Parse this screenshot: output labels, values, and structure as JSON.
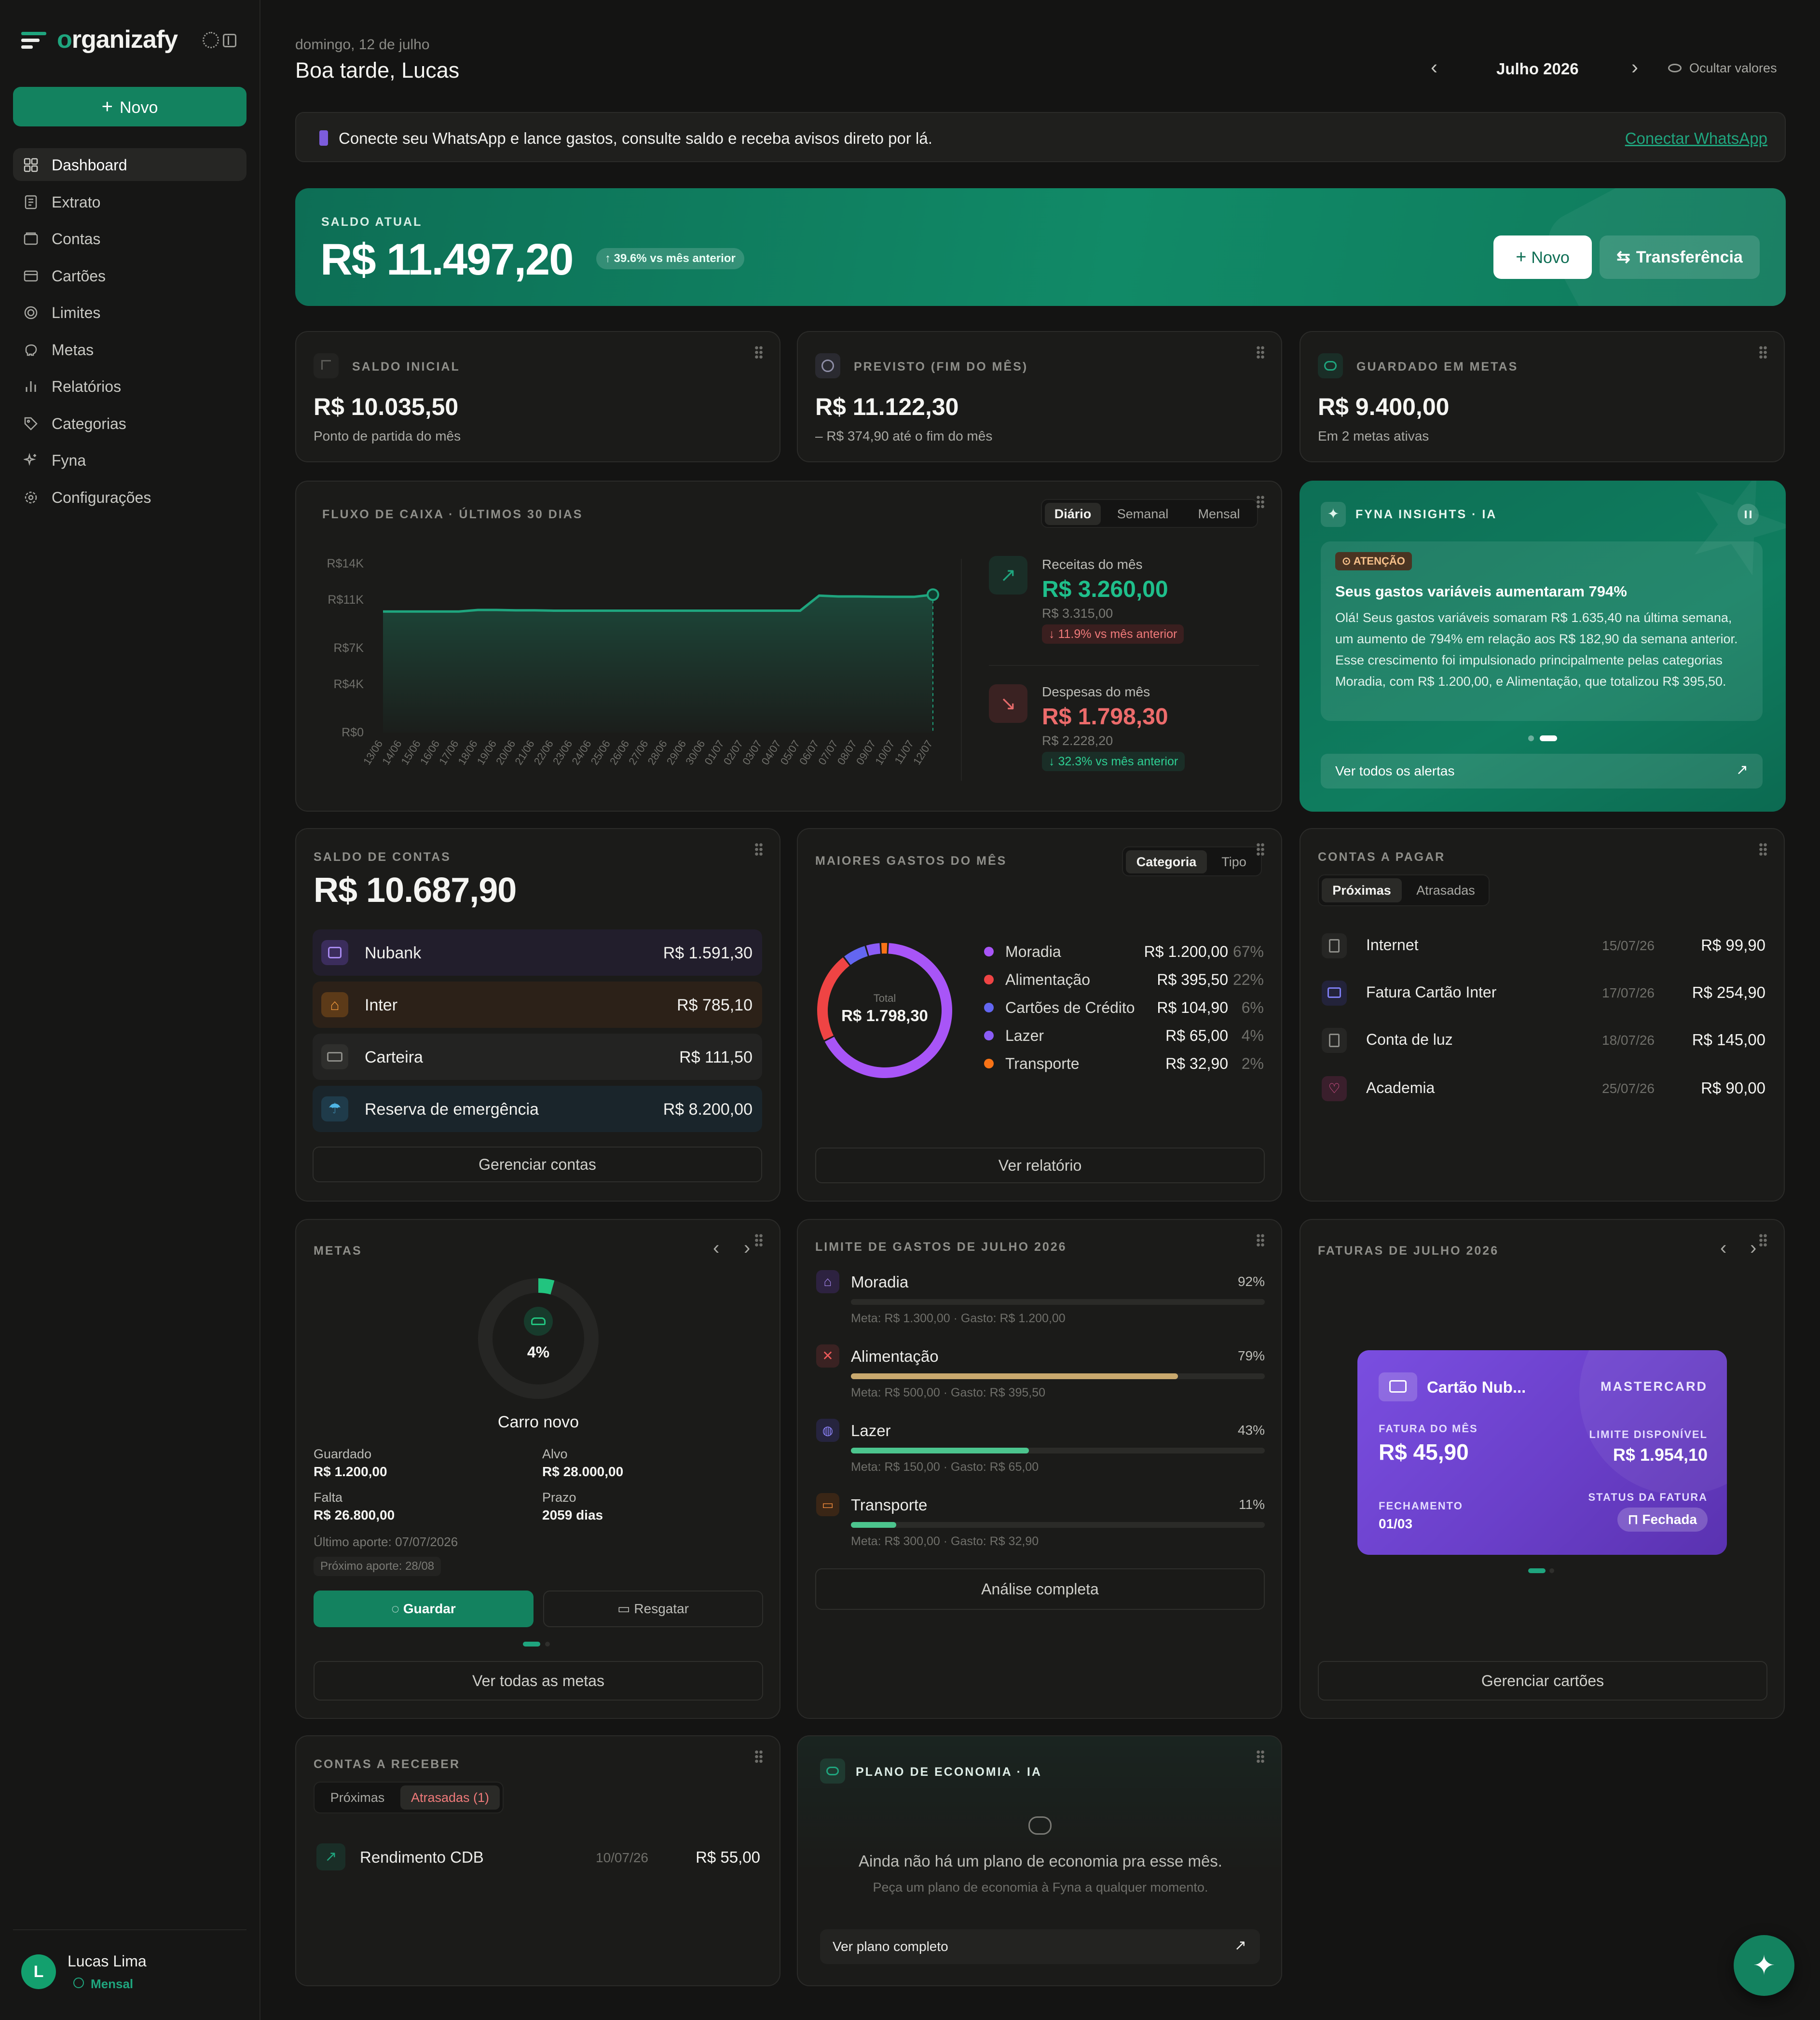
{
  "brand": {
    "name_prefix": "o",
    "name_rest": "rganizafy"
  },
  "sidebar": {
    "new_label": "Novo",
    "items": [
      {
        "label": "Dashboard"
      },
      {
        "label": "Extrato"
      },
      {
        "label": "Contas"
      },
      {
        "label": "Cartões"
      },
      {
        "label": "Limites"
      },
      {
        "label": "Metas"
      },
      {
        "label": "Relatórios"
      },
      {
        "label": "Categorias"
      },
      {
        "label": "Fyna"
      },
      {
        "label": "Configurações"
      }
    ],
    "user": {
      "initial": "L",
      "name": "Lucas Lima",
      "plan": "Mensal"
    }
  },
  "header": {
    "date": "domingo, 12 de julho",
    "greeting": "Boa tarde, Lucas",
    "month": "Julho 2026",
    "hide_values": "Ocultar valores"
  },
  "banner": {
    "text": "Conecte seu WhatsApp e lance gastos, consulte saldo e receba avisos direto por lá.",
    "link": "Conectar WhatsApp"
  },
  "hero": {
    "label": "SALDO ATUAL",
    "value": "R$ 11.497,20",
    "badge": "39.6% vs mês anterior",
    "new_btn": "Novo",
    "transfer_btn": "Transferência",
    "accent": "#13785e"
  },
  "stats": [
    {
      "label": "SALDO INICIAL",
      "value": "R$ 10.035,50",
      "sub": "Ponto de partida do mês"
    },
    {
      "label": "PREVISTO (FIM DO MÊS)",
      "value": "R$ 11.122,30",
      "sub": "– R$ 374,90 até o fim do mês"
    },
    {
      "label": "GUARDADO EM METAS",
      "value": "R$ 9.400,00",
      "sub": "Em 2 metas ativas"
    }
  ],
  "cashflow": {
    "title": "FLUXO DE CAIXA · ÚLTIMOS 30 DIAS",
    "tabs": [
      "Diário",
      "Semanal",
      "Mensal"
    ],
    "income": {
      "label": "Receitas do mês",
      "value": "R$ 3.260,00",
      "prev": "R$ 3.315,00",
      "delta": "11.9% vs mês anterior"
    },
    "expense": {
      "label": "Despesas do mês",
      "value": "R$ 1.798,30",
      "prev": "R$ 2.228,20",
      "delta": "32.3% vs mês anterior"
    }
  },
  "chart_data": {
    "type": "area",
    "title": "",
    "xlabel": "",
    "ylabel": "",
    "y_ticks": [
      "R$14K",
      "R$11K",
      "R$7K",
      "R$4K",
      "R$0"
    ],
    "ylim": [
      0,
      14000
    ],
    "categories": [
      "13/06",
      "14/06",
      "15/06",
      "16/06",
      "17/06",
      "18/06",
      "19/06",
      "20/06",
      "21/06",
      "22/06",
      "23/06",
      "24/06",
      "25/06",
      "26/06",
      "27/06",
      "28/06",
      "29/06",
      "30/06",
      "01/07",
      "02/07",
      "03/07",
      "04/07",
      "05/07",
      "06/07",
      "07/07",
      "08/07",
      "09/07",
      "10/07",
      "11/07",
      "12/07"
    ],
    "series": [
      {
        "values": [
          10030,
          10030,
          10030,
          10030,
          10030,
          10160,
          10160,
          10130,
          10130,
          10100,
          10100,
          10100,
          10100,
          10100,
          10100,
          10100,
          10100,
          10100,
          10100,
          10100,
          10100,
          10100,
          10100,
          11350,
          11280,
          11280,
          11260,
          11250,
          11250,
          11430
        ]
      }
    ],
    "grid": false,
    "color": "#1fa57e"
  },
  "insights": {
    "title": "FYNA INSIGHTS · IA",
    "tag": "ATENÇÃO",
    "headline": "Seus gastos variáveis aumentaram 794%",
    "body": "Olá! Seus gastos variáveis somaram R$ 1.635,40 na última semana, um aumento de 794% em relação aos R$ 182,90 da semana anterior. Esse crescimento foi impulsionado principalmente pelas categorias Moradia, com R$ 1.200,00, e Alimentação, que totalizou R$ 395,50.",
    "link": "Ver todos os alertas"
  },
  "accounts": {
    "label": "SALDO DE CONTAS",
    "total": "R$ 10.687,90",
    "items": [
      {
        "name": "Nubank",
        "value": "R$ 1.591,30"
      },
      {
        "name": "Inter",
        "value": "R$ 785,10"
      },
      {
        "name": "Carteira",
        "value": "R$ 111,50"
      },
      {
        "name": "Reserva de emergência",
        "value": "R$ 8.200,00"
      }
    ],
    "manage": "Gerenciar contas"
  },
  "spending": {
    "label": "MAIORES GASTOS DO MÊS",
    "tabs": [
      "Categoria",
      "Tipo"
    ],
    "total_label": "Total",
    "total": "R$ 1.798,30",
    "items": [
      {
        "name": "Moradia",
        "value": "R$ 1.200,00",
        "pct": "67%",
        "share": 0.667,
        "color": "#a855f7"
      },
      {
        "name": "Alimentação",
        "value": "R$ 395,50",
        "pct": "22%",
        "share": 0.22,
        "color": "#ef4444"
      },
      {
        "name": "Cartões de Crédito",
        "value": "R$ 104,90",
        "pct": "6%",
        "share": 0.058,
        "color": "#6366f1"
      },
      {
        "name": "Lazer",
        "value": "R$ 65,00",
        "pct": "4%",
        "share": 0.036,
        "color": "#8b5cf6"
      },
      {
        "name": "Transporte",
        "value": "R$ 32,90",
        "pct": "2%",
        "share": 0.018,
        "color": "#f97316"
      }
    ],
    "report": "Ver relatório"
  },
  "payables": {
    "label": "CONTAS A PAGAR",
    "tabs": [
      "Próximas",
      "Atrasadas"
    ],
    "items": [
      {
        "name": "Internet",
        "date": "15/07/26",
        "value": "R$ 99,90"
      },
      {
        "name": "Fatura Cartão Inter",
        "date": "17/07/26",
        "value": "R$ 254,90"
      },
      {
        "name": "Conta de luz",
        "date": "18/07/26",
        "value": "R$ 145,00"
      },
      {
        "name": "Academia",
        "date": "25/07/26",
        "value": "R$ 90,00"
      }
    ]
  },
  "goals": {
    "label": "METAS",
    "percent": "4%",
    "progress": 0.043,
    "name": "Carro novo",
    "saved_label": "Guardado",
    "saved": "R$ 1.200,00",
    "target_label": "Alvo",
    "target": "R$ 28.000,00",
    "missing_label": "Falta",
    "missing": "R$ 26.800,00",
    "deadline_label": "Prazo",
    "deadline": "2059 dias",
    "last": "Último aporte: 07/07/2026",
    "next": "Próximo aporte: 28/08",
    "save_btn": "Guardar",
    "withdraw_btn": "Resgatar",
    "all": "Ver todas as metas"
  },
  "limits": {
    "label": "LIMITE DE GASTOS DE JULHO 2026",
    "items": [
      {
        "name": "Moradia",
        "pct": "92%",
        "fill": 0.0,
        "meta": "Meta: R$ 1.300,00 · Gasto: R$ 1.200,00",
        "color": "#a855f7"
      },
      {
        "name": "Alimentação",
        "pct": "79%",
        "fill": 0.79,
        "meta": "Meta: R$ 500,00 · Gasto: R$ 395,50",
        "color": "#c9a96e"
      },
      {
        "name": "Lazer",
        "pct": "43%",
        "fill": 0.43,
        "meta": "Meta: R$ 150,00 · Gasto: R$ 65,00",
        "color": "#4cc58e"
      },
      {
        "name": "Transporte",
        "pct": "11%",
        "fill": 0.11,
        "meta": "Meta: R$ 300,00 · Gasto: R$ 32,90",
        "color": "#4cc58e"
      }
    ],
    "analysis": "Análise completa"
  },
  "invoices": {
    "label": "FATURAS DE JULHO 2026",
    "card_name": "Cartão Nub...",
    "brand": "MASTERCARD",
    "invoice_label": "FATURA DO MÊS",
    "invoice_value": "R$ 45,90",
    "limit_label": "LIMITE DISPONÍVEL",
    "limit_value": "R$ 1.954,10",
    "closing_label": "FECHAMENTO",
    "closing_value": "01/03",
    "status_label": "STATUS DA FATURA",
    "status_value": "Fechada",
    "manage": "Gerenciar cartões"
  },
  "receivables": {
    "label": "CONTAS A RECEBER",
    "tabs": [
      "Próximas",
      "Atrasadas (1)"
    ],
    "items": [
      {
        "name": "Rendimento CDB",
        "date": "10/07/26",
        "value": "R$ 55,00"
      }
    ]
  },
  "savings_plan": {
    "label": "PLANO DE ECONOMIA · IA",
    "empty": "Ainda não há um plano de economia pra esse mês.",
    "hint": "Peça um plano de economia à Fyna a qualquer momento.",
    "link": "Ver plano completo"
  }
}
